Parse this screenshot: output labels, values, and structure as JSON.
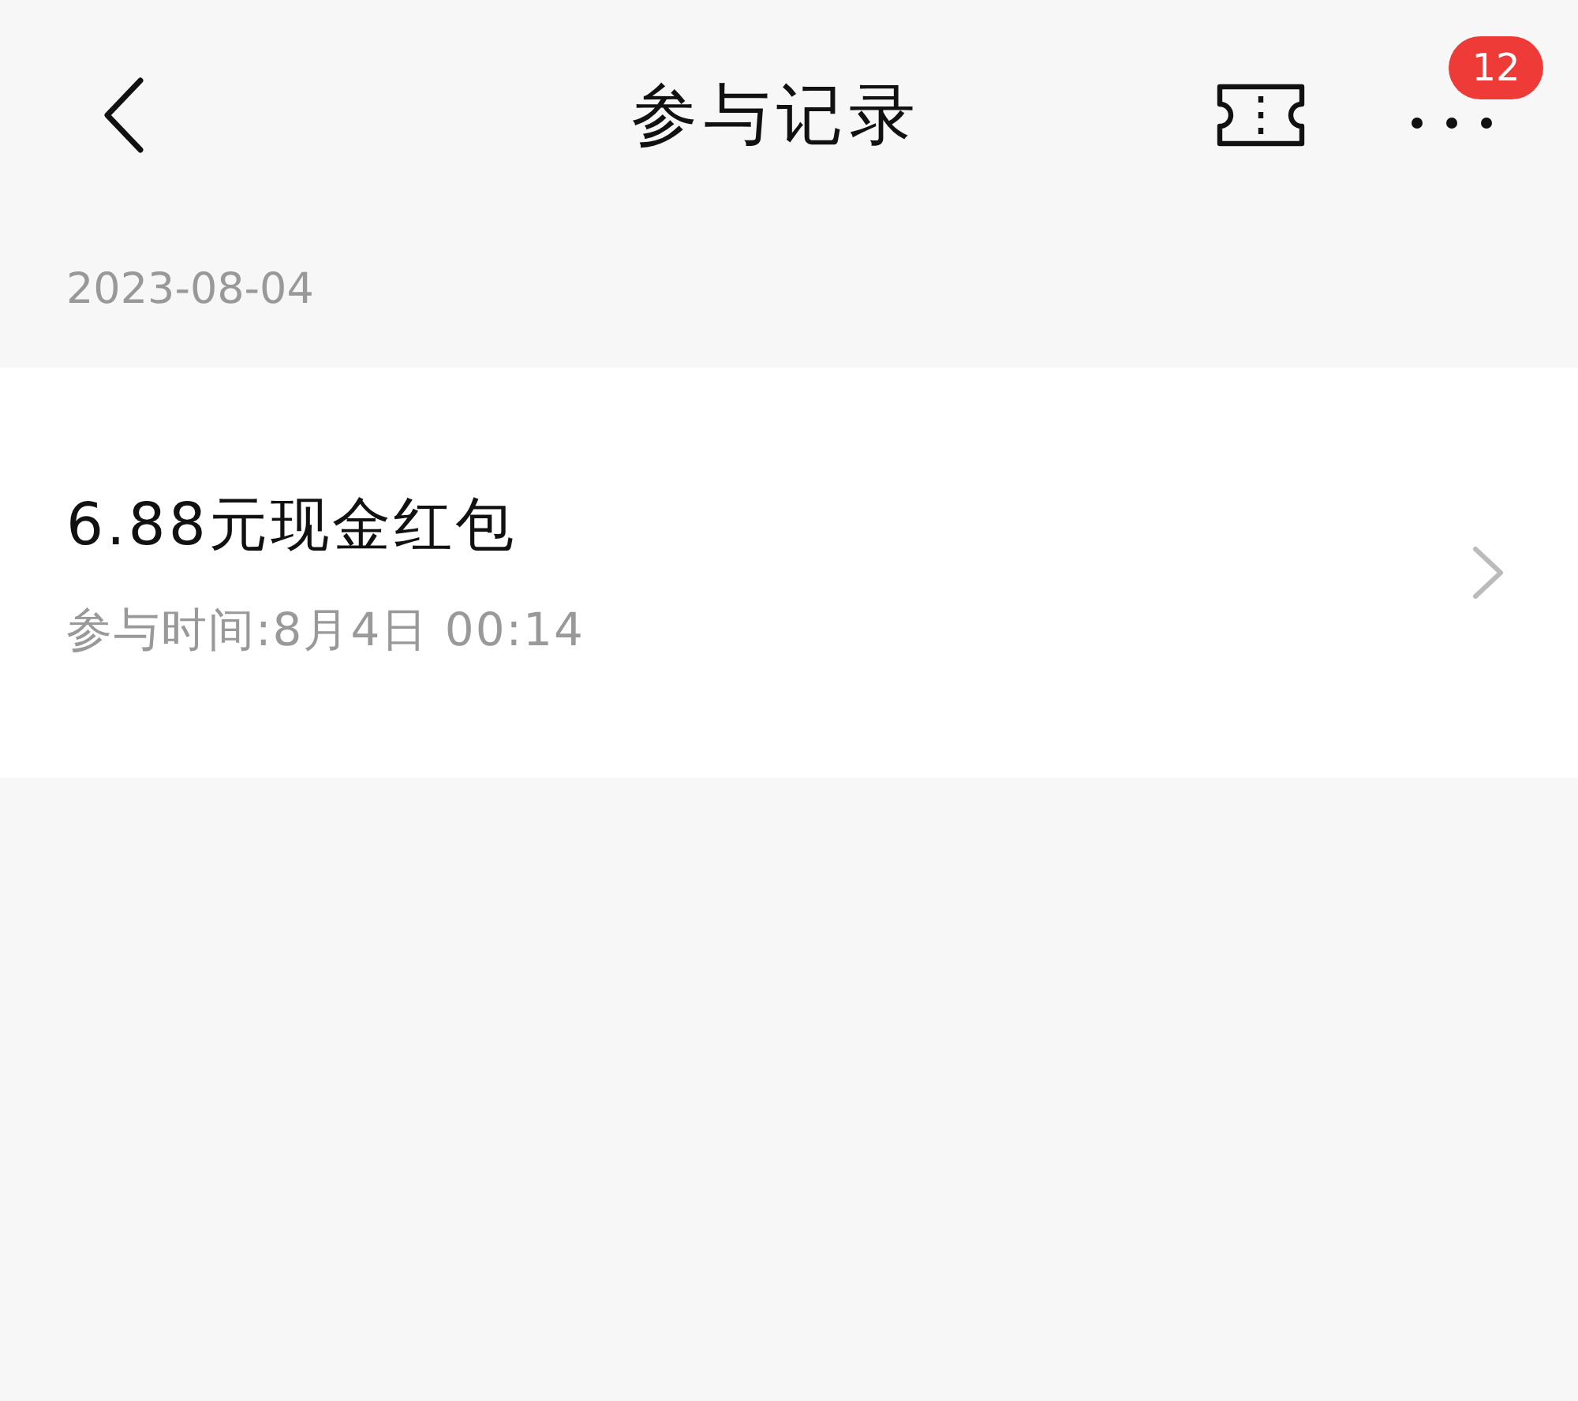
{
  "header": {
    "title": "参与记录",
    "badge": "12"
  },
  "groups": [
    {
      "date": "2023-08-04",
      "records": [
        {
          "title": "6.88元现金红包",
          "time": "参与时间:8月4日 00:14"
        }
      ]
    }
  ]
}
